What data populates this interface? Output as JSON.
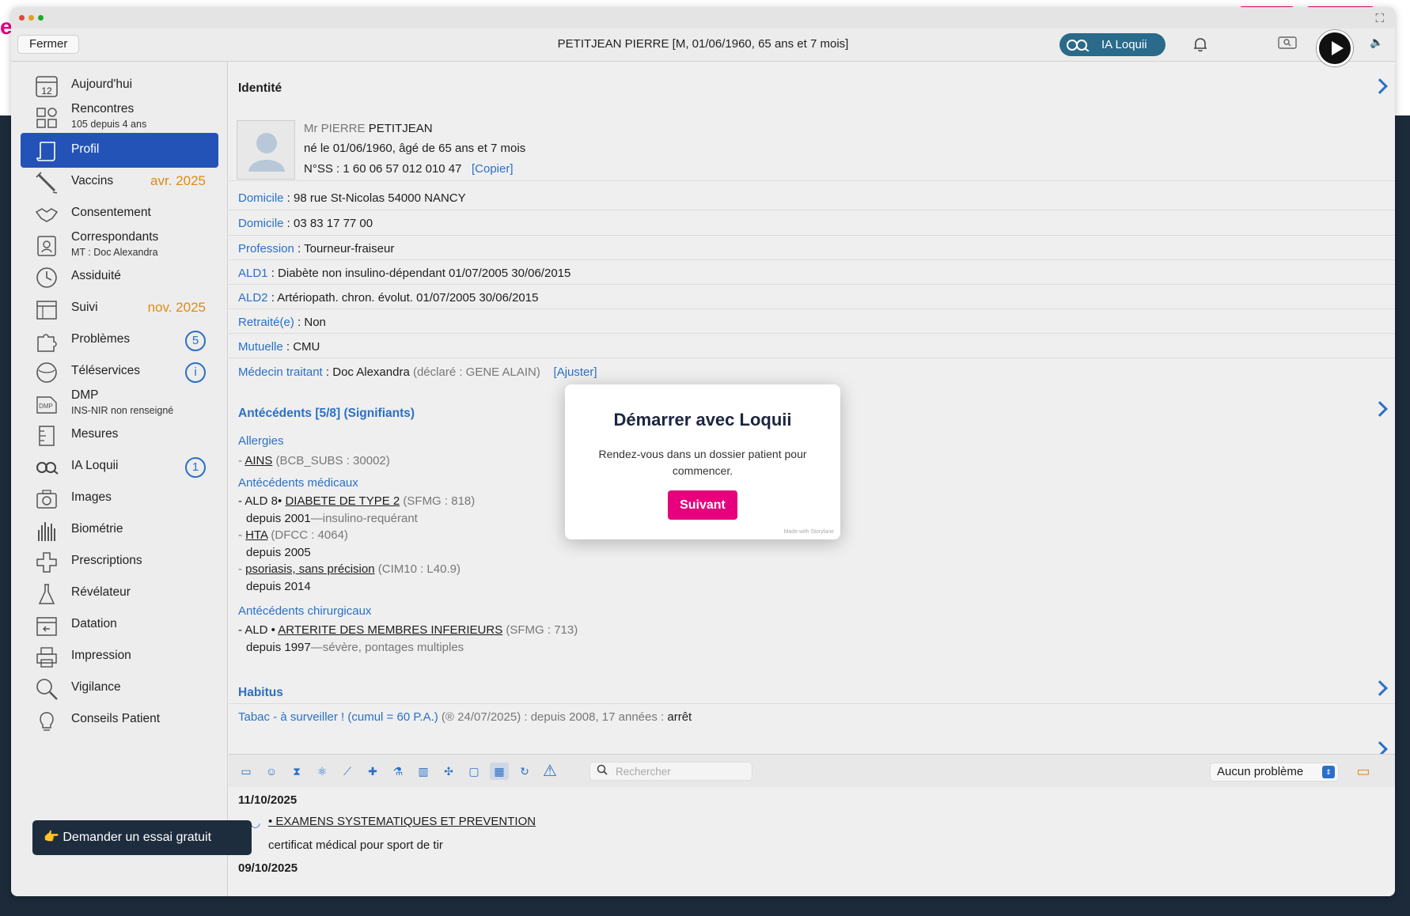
{
  "window": {
    "close_label": "Fermer",
    "title": "PETITJEAN PIERRE [M, 01/06/1960, 65 ans et 7 mois]",
    "ia_label": "IA Loquii"
  },
  "edge_text": "e",
  "sidebar": {
    "items": [
      {
        "label": "Aujourd'hui",
        "icon_text": "12"
      },
      {
        "label": "Rencontres",
        "sub": "105 depuis 4 ans"
      },
      {
        "label": "Profil"
      },
      {
        "label": "Vaccins",
        "date": "avr. 2025"
      },
      {
        "label": "Consentement"
      },
      {
        "label": "Correspondants",
        "sub": "MT : Doc Alexandra"
      },
      {
        "label": "Assiduité"
      },
      {
        "label": "Suivi",
        "date": "nov. 2025"
      },
      {
        "label": "Problèmes",
        "badge": "5"
      },
      {
        "label": "Téléservices",
        "badge": "i"
      },
      {
        "label": "DMP",
        "sub": "INS-NIR non renseigné",
        "icon_text": "DMP"
      },
      {
        "label": "Mesures"
      },
      {
        "label": "IA Loquii",
        "badge": "1"
      },
      {
        "label": "Images"
      },
      {
        "label": "Biométrie"
      },
      {
        "label": "Prescriptions"
      },
      {
        "label": "Révélateur"
      },
      {
        "label": "Datation"
      },
      {
        "label": "Impression"
      },
      {
        "label": "Vigilance"
      },
      {
        "label": "Conseils Patient"
      }
    ],
    "trial_label": "👉  Demander un essai gratuit"
  },
  "identity": {
    "title": "Identité",
    "civility": "Mr PIERRE",
    "lastname": "PETITJEAN",
    "birth": "né le 01/06/1960, âgé de 65 ans et 7 mois",
    "nss": "N°SS : 1 60 06 57 012 010 47",
    "copy": "[Copier]",
    "rows": [
      {
        "label": "Domicile",
        "value": " : 98 rue St-Nicolas 54000 NANCY"
      },
      {
        "label": "Domicile",
        "value": " : 03 83 17 77 00"
      },
      {
        "label": "Profession",
        "value": " : Tourneur-fraiseur"
      },
      {
        "label": "ALD1",
        "value": " : Diabète non insulino-dépendant 01/07/2005 30/06/2015"
      },
      {
        "label": "ALD2",
        "value": " : Artériopath. chron. évolut. 01/07/2005 30/06/2015"
      },
      {
        "label": "Retraité(e)",
        "value": " : Non"
      },
      {
        "label": "Mutuelle",
        "value": " : CMU"
      }
    ],
    "doctor_label": "Médecin traitant",
    "doctor_value": " : Doc Alexandra",
    "doctor_declared": " (déclaré : GENE ALAIN)",
    "adjust": "[Ajuster]"
  },
  "antecedents": {
    "title": "Antécédents [5/8] (Signifiants)",
    "allergies_title": "Allergies",
    "allergy_prefix": "- ",
    "allergy_name": "AINS",
    "allergy_code": " (BCB_SUBS : 30002)",
    "medical_title": "Antécédents médicaux",
    "med1_prefix": "- ALD 8• ",
    "med1_name": "DIABETE DE TYPE 2",
    "med1_code": " (SFMG : 818)",
    "med1_since": "depuis 2001",
    "med1_note": "—insulino-requérant",
    "med2_prefix": "- ",
    "med2_name": "HTA",
    "med2_code": " (DFCC : 4064)",
    "med2_since": "depuis 2005",
    "med3_prefix": "- ",
    "med3_name": "psoriasis, sans précision",
    "med3_code": " (CIM10 : L40.9)",
    "med3_since": "depuis 2014",
    "surgical_title": "Antécédents chirurgicaux",
    "surg1_prefix": "- ALD • ",
    "surg1_name": "ARTERITE DES MEMBRES INFERIEURS",
    "surg1_code": " (SFMG : 713)",
    "surg1_since": "depuis 1997",
    "surg1_note": "—sévère, pontages multiples"
  },
  "habitus": {
    "title": "Habitus",
    "tobacco_label": "Tabac - à surveiller ! (cumul = 60 P.A.)",
    "tobacco_date": " (® 24/07/2025)",
    "tobacco_since": " : depuis 2008, 17 années : ",
    "tobacco_status": "arrêt"
  },
  "bottom": {
    "search_placeholder": "Rechercher",
    "problem_select": "Aucun problème"
  },
  "journal": {
    "date1": "11/10/2025",
    "entry1": "• EXAMENS SYSTEMATIQUES ET PREVENTION",
    "entry1b": "certificat médical pour sport de tir",
    "date2": "09/10/2025"
  },
  "modal": {
    "title": "Démarrer avec Loquii",
    "body": "Rendez-vous dans un dossier patient pour commencer.",
    "button": "Suivant",
    "made_with": "Made with Storylane"
  },
  "colors": {
    "accent_blue": "#2a70c8",
    "active_blue": "#2453b8",
    "brand_pink": "#e6007e",
    "date_orange": "#e08a10"
  }
}
